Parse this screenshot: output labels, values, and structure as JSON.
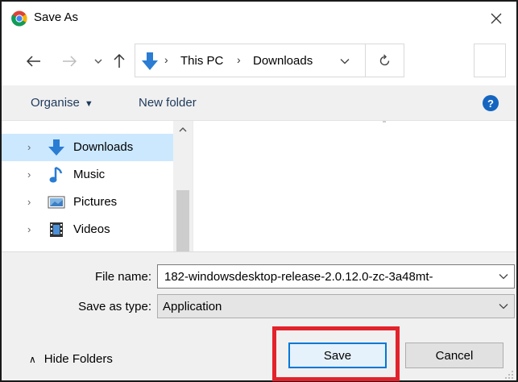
{
  "window": {
    "title": "Save As",
    "app_icon": "chrome-icon",
    "close_icon": "close-icon"
  },
  "navigation": {
    "back_icon": "back-arrow-icon",
    "forward_icon": "forward-arrow-icon",
    "recent_icon": "chevron-down-icon",
    "up_icon": "up-arrow-icon",
    "breadcrumb": [
      "This PC",
      "Downloads"
    ],
    "refresh_icon": "refresh-icon"
  },
  "toolbar": {
    "organise_label": "Organise",
    "new_folder_label": "New folder",
    "help_label": "?"
  },
  "nav_pane": {
    "items": [
      {
        "label": "Downloads",
        "icon": "download-arrow-icon",
        "selected": true
      },
      {
        "label": "Music",
        "icon": "music-note-icon",
        "selected": false
      },
      {
        "label": "Pictures",
        "icon": "pictures-icon",
        "selected": false
      },
      {
        "label": "Videos",
        "icon": "videos-icon",
        "selected": false
      }
    ]
  },
  "form": {
    "file_name_label": "File name:",
    "file_name_value": "182-windowsdesktop-release-2.0.12.0-zc-3a48mt-",
    "save_type_label": "Save as type:",
    "save_type_value": "Application"
  },
  "footer": {
    "hide_folders_label": "Hide Folders",
    "save_label": "Save",
    "cancel_label": "Cancel"
  },
  "colors": {
    "highlight": "#e3222b",
    "selected_item": "#cce8ff",
    "accent": "#0078d7"
  }
}
